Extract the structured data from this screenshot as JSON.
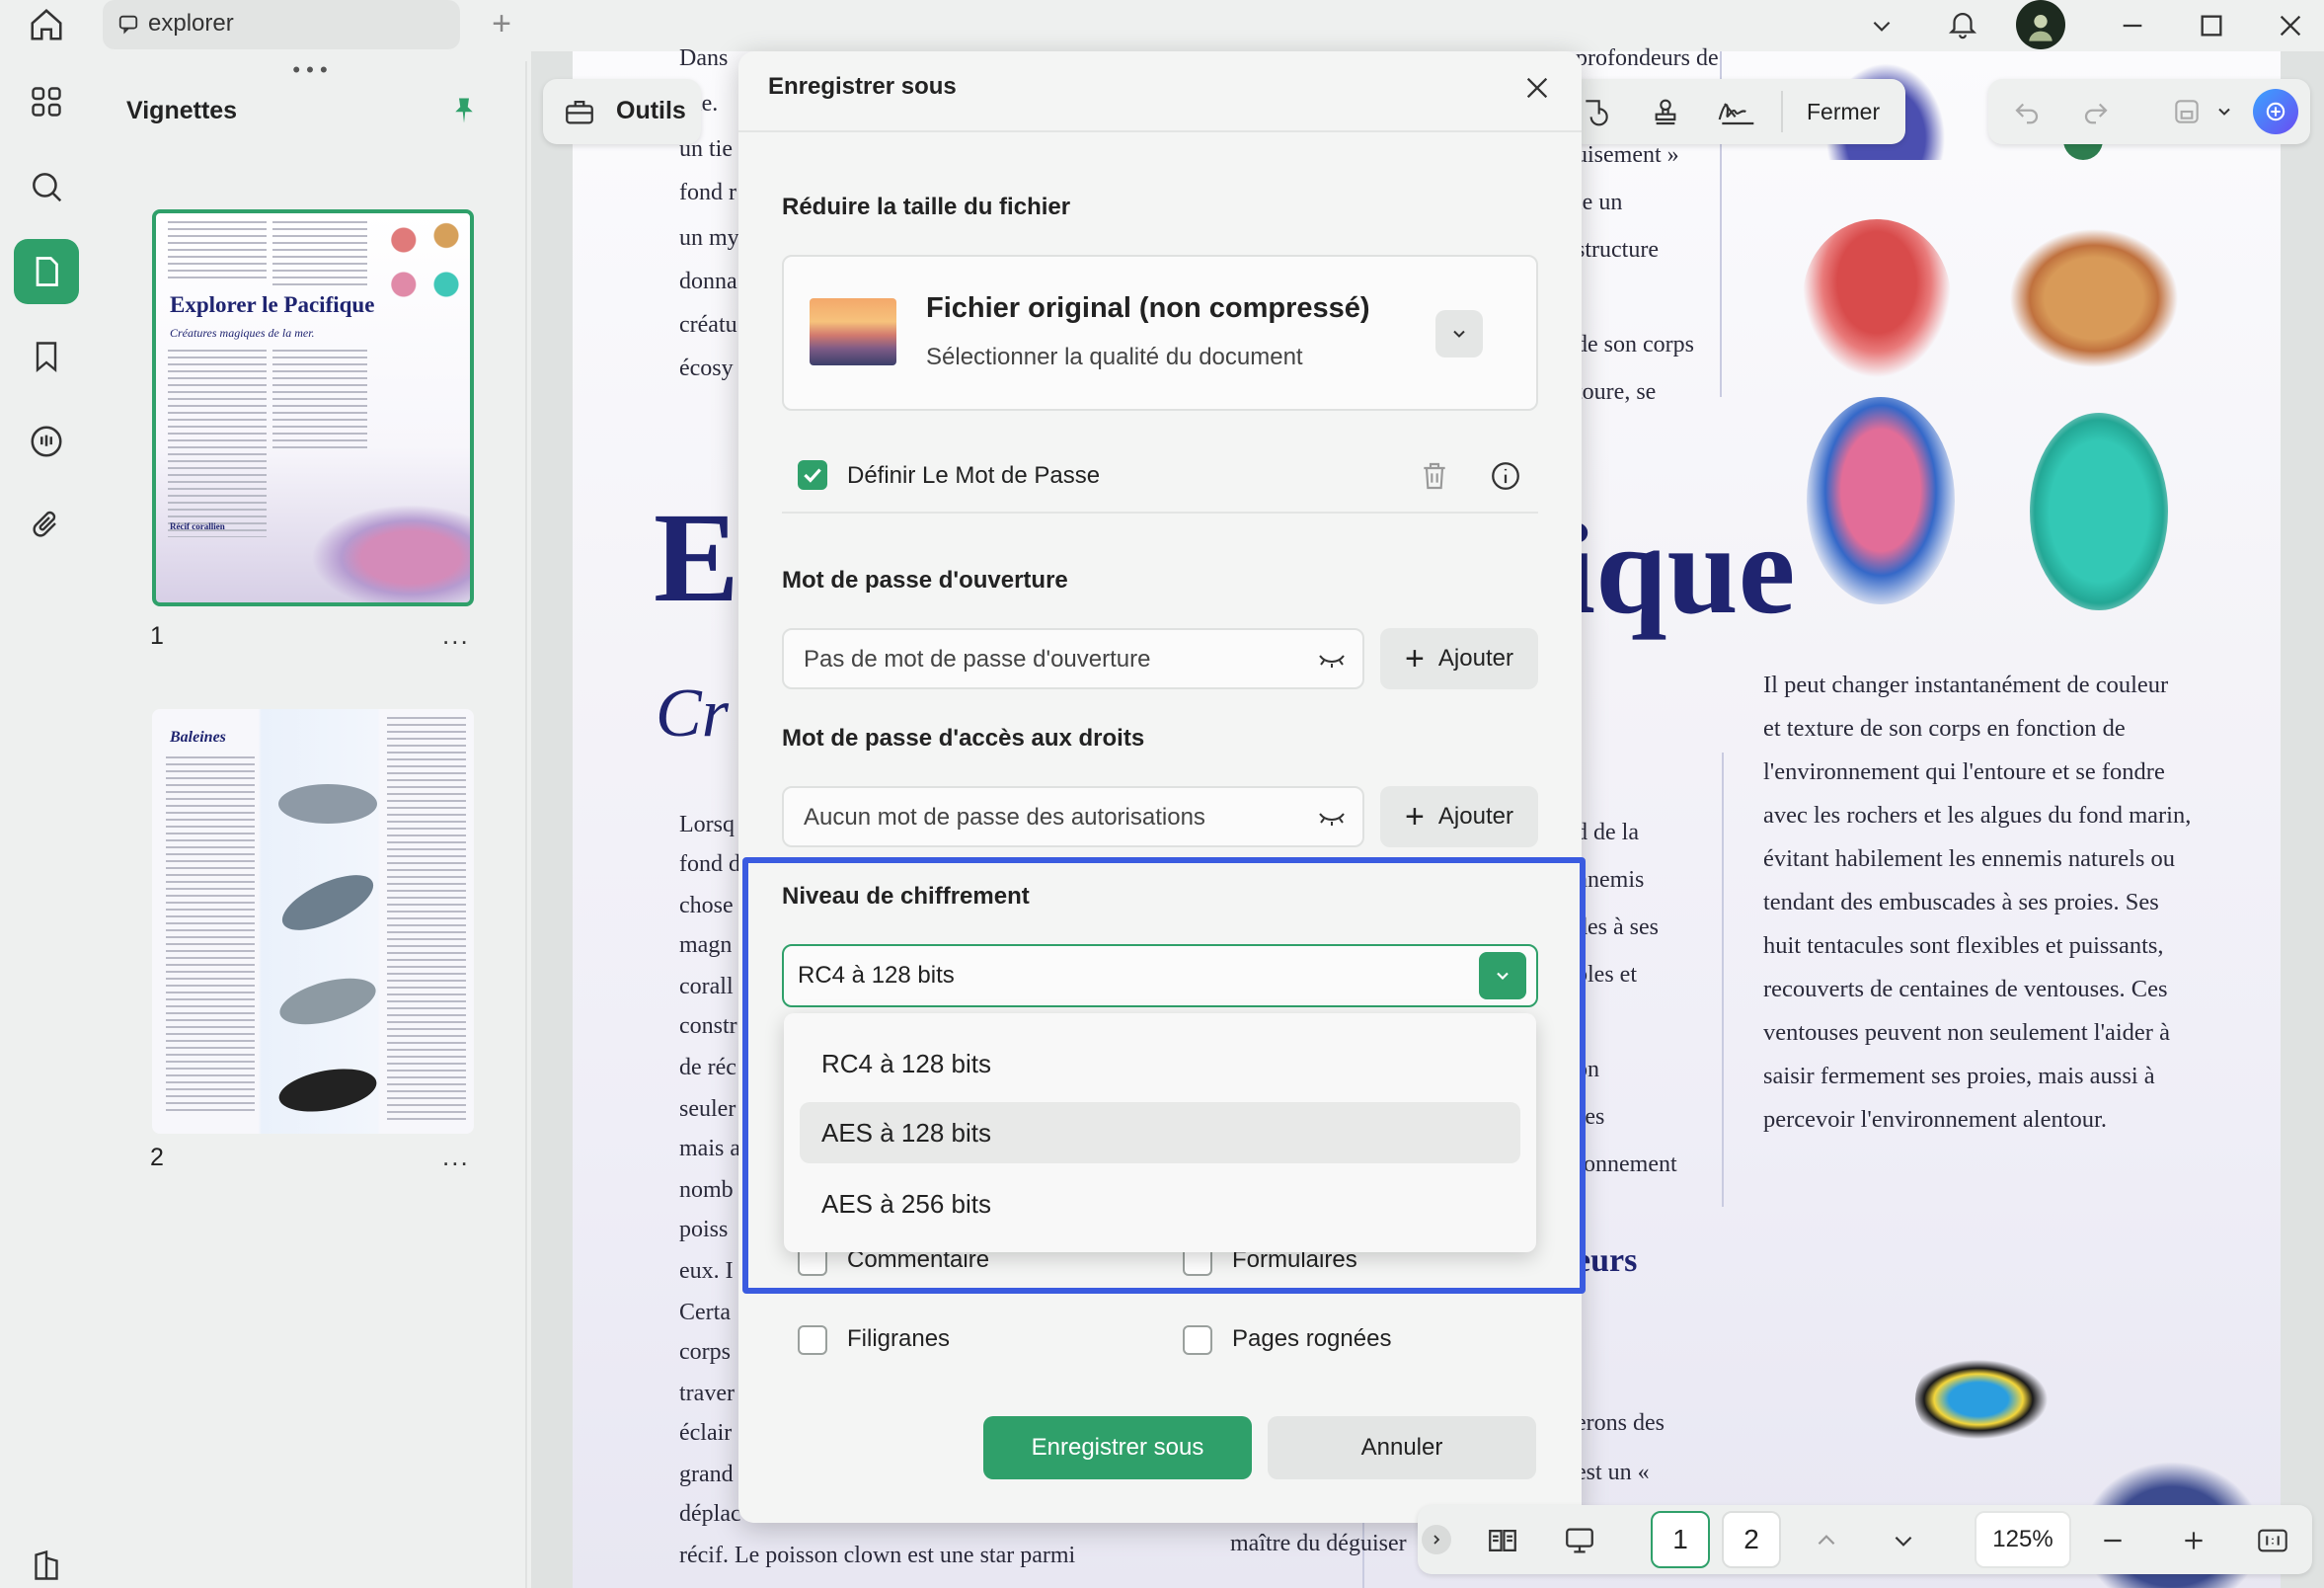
{
  "window": {
    "tab_title": "explorer",
    "colors": {
      "accent": "#2fa06a",
      "highlight": "#3a5be0"
    }
  },
  "sidebar": {
    "panel_title": "Vignettes",
    "pages": [
      {
        "number": "1",
        "more": "...",
        "title": "Explorer le Pacifique",
        "subtitle": "Créatures magiques de la mer.",
        "section": "Récif corallien"
      },
      {
        "number": "2",
        "more": "...",
        "title": "Baleines"
      }
    ]
  },
  "toolbar": {
    "tools_label": "Outils",
    "close_label": "Fermer"
  },
  "document": {
    "big_heading_left": "E",
    "big_heading_right": "ique",
    "subheading_left": "Cr",
    "top_left_fragments": [
      "Dans",
      "eue.",
      "un tie",
      "fond r",
      "un my",
      "donna",
      "créatu",
      "écosy"
    ],
    "top_right_fragments": [
      "profondeurs de",
      "uisement »",
      "le un",
      "structure",
      "de son corps",
      "toure, se"
    ],
    "left_column_fragments": [
      "Lorsq",
      "fond d",
      "chose",
      "magn",
      "corall",
      "constr",
      "de réc",
      "seuler",
      "mais a",
      "nomb",
      "poiss",
      "eux. I",
      "Certa",
      "corps",
      "traver",
      "éclair",
      "grand",
      "déplac"
    ],
    "mid_column_fragments": [
      "d de la",
      "nnemis",
      "des à ses",
      "bles et",
      "e",
      "on",
      "ses",
      "ronnement"
    ],
    "subheading_right": "eurs",
    "bottom_mid_fragments": [
      "erons des",
      "est un «"
    ],
    "bottom_left_line": "récif. Le poisson clown est une star parmi",
    "bottom_mid_line": "maître du déguiser",
    "right_paragraph": [
      "Il peut changer instantanément de couleur",
      "et texture de son corps en fonction de",
      "l'environnement qui l'entoure et se fondre",
      "avec les rochers et les algues du fond marin,",
      "évitant habilement les ennemis naturels ou",
      "tendant des embuscades à ses proies. Ses",
      "huit tentacules sont flexibles et puissants,",
      "recouverts de centaines de ventouses. Ces",
      "ventouses peuvent non seulement l'aider à",
      "saisir fermement ses proies, mais aussi à",
      "percevoir l'environnement alentour."
    ]
  },
  "dialog": {
    "title": "Enregistrer sous",
    "reduce_section": "Réduire la taille du fichier",
    "quality_title": "Fichier original (non compressé)",
    "quality_subtitle": "Sélectionner la qualité du document",
    "set_password_label": "Définir Le Mot de Passe",
    "set_password_checked": true,
    "open_password_section": "Mot de passe d'ouverture",
    "open_password_placeholder": "Pas de mot de passe d'ouverture",
    "permissions_section": "Mot de passe d'accès aux droits",
    "permissions_placeholder": "Aucun mot de passe des autorisations",
    "add_label": "Ajouter",
    "encryption_section": "Niveau de chiffrement",
    "encryption_selected": "RC4 à 128 bits",
    "encryption_options": [
      "RC4 à 128 bits",
      "AES à 128 bits",
      "AES à 256 bits"
    ],
    "permissions": [
      {
        "label": "Commentaire",
        "checked": false
      },
      {
        "label": "Formulaires",
        "checked": false
      },
      {
        "label": "Filigranes",
        "checked": false
      },
      {
        "label": "Pages rognées",
        "checked": false
      }
    ],
    "save_label": "Enregistrer sous",
    "cancel_label": "Annuler"
  },
  "bottom_nav": {
    "page_1": "1",
    "page_2": "2",
    "zoom": "125%"
  }
}
